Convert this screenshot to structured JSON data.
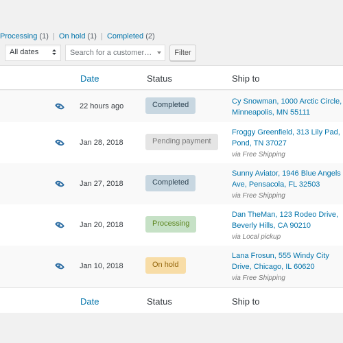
{
  "filters": {
    "processing_label": "Processing",
    "processing_count": "(1)",
    "on_hold_label": "On hold",
    "on_hold_count": "(1)",
    "completed_label": "Completed",
    "completed_count": "(2)",
    "separator": "|"
  },
  "toolbar": {
    "dates_value": "All dates",
    "search_placeholder": "Search for a customer…",
    "filter_label": "Filter"
  },
  "columns": {
    "date": "Date",
    "status": "Status",
    "ship_to": "Ship to"
  },
  "orders": [
    {
      "date": "22 hours ago",
      "status": "Completed",
      "status_bg": "#c8d7e1",
      "status_color": "#2e4453",
      "ship_line1": "Cy Snowman, 1000 Arctic Circle,",
      "ship_line2": "Minneapolis, MN 55111",
      "via": ""
    },
    {
      "date": "Jan 28, 2018",
      "status": "Pending payment",
      "status_bg": "#e5e5e5",
      "status_color": "#777777",
      "ship_line1": "Froggy Greenfield, 313 Lily Pad,",
      "ship_line2": "Pond, TN 37027",
      "via": "via Free Shipping"
    },
    {
      "date": "Jan 27, 2018",
      "status": "Completed",
      "status_bg": "#c8d7e1",
      "status_color": "#2e4453",
      "ship_line1": "Sunny Aviator, 1946 Blue Angels",
      "ship_line2": "Ave, Pensacola, FL 32503",
      "via": "via Free Shipping"
    },
    {
      "date": "Jan 20, 2018",
      "status": "Processing",
      "status_bg": "#c6e1c6",
      "status_color": "#5b841b",
      "ship_line1": "Dan TheMan, 123 Rodeo Drive,",
      "ship_line2": "Beverly Hills, CA 90210",
      "via": "via Local pickup"
    },
    {
      "date": "Jan 10, 2018",
      "status": "On hold",
      "status_bg": "#f8dda7",
      "status_color": "#94660c",
      "ship_line1": "Lana Frosun, 555 Windy City",
      "ship_line2": "Drive, Chicago, IL 60620",
      "via": "via Free Shipping"
    }
  ],
  "colors": {
    "link": "#0073aa",
    "background": "#f1f1f1"
  },
  "icons": {
    "preview": "eye-icon",
    "select": "chevron-updown-icon",
    "dropdown": "chevron-down-icon"
  }
}
